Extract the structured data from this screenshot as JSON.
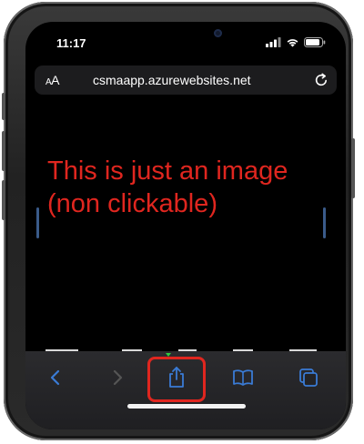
{
  "status_bar": {
    "time": "11:17",
    "icons": [
      "signal-icon",
      "wifi-icon",
      "battery-icon"
    ]
  },
  "address_bar": {
    "text_size_label_small": "A",
    "text_size_label_large": "A",
    "url": "csmaapp.azurewebsites.net",
    "reload_icon": "reload-icon"
  },
  "content": {
    "overlay_line1": "This is just an image",
    "overlay_line2": "(non clickable)"
  },
  "toolbar": {
    "buttons": [
      "back-icon",
      "forward-icon",
      "share-icon",
      "bookmarks-icon",
      "tabs-icon"
    ],
    "highlighted": "share-icon"
  },
  "colors": {
    "annotation": "#e0261f",
    "toolbar_icon": "#3a7bd5",
    "toolbar_icon_disabled": "#555555"
  }
}
